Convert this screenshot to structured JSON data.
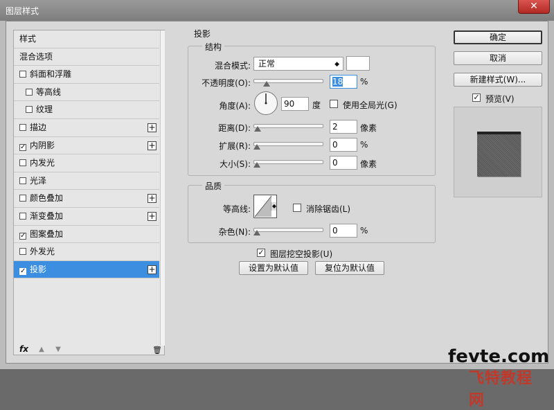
{
  "window": {
    "title": "图层样式",
    "close_label": "✕"
  },
  "list": {
    "header_label": "样式",
    "blend_options_label": "混合选项",
    "items": [
      {
        "label": "斜面和浮雕",
        "checked": false,
        "sub": false,
        "plus": false
      },
      {
        "label": "等高线",
        "checked": false,
        "sub": true,
        "plus": false
      },
      {
        "label": "纹理",
        "checked": false,
        "sub": true,
        "plus": false
      },
      {
        "label": "描边",
        "checked": false,
        "sub": false,
        "plus": true
      },
      {
        "label": "内阴影",
        "checked": true,
        "sub": false,
        "plus": true
      },
      {
        "label": "内发光",
        "checked": false,
        "sub": false,
        "plus": false
      },
      {
        "label": "光泽",
        "checked": false,
        "sub": false,
        "plus": false
      },
      {
        "label": "颜色叠加",
        "checked": false,
        "sub": false,
        "plus": true
      },
      {
        "label": "渐变叠加",
        "checked": false,
        "sub": false,
        "plus": true
      },
      {
        "label": "图案叠加",
        "checked": true,
        "sub": false,
        "plus": false
      },
      {
        "label": "外发光",
        "checked": false,
        "sub": false,
        "plus": false
      },
      {
        "label": "投影",
        "checked": true,
        "sub": false,
        "plus": true,
        "active": true
      }
    ],
    "fx_label": "fx",
    "up_icon": "▲",
    "down_icon": "▼",
    "trash_icon": "🗑",
    "plus_icon": "+",
    "check_mark": "✓"
  },
  "drop_shadow": {
    "section_title": "投影",
    "structure": {
      "title": "结构",
      "blend_mode_label": "混合模式:",
      "blend_mode_value": "正常",
      "blend_caret": "◆",
      "opacity_label": "不透明度(O):",
      "opacity_value": "18",
      "opacity_fraction": 0.18,
      "opacity_unit": "%",
      "angle_label": "角度(A):",
      "angle_value": "90",
      "angle_unit": "度",
      "global_light_label": "使用全局光(G)",
      "distance_label": "距离(D):",
      "distance_value": "2",
      "distance_unit": "像素",
      "spread_label": "扩展(R):",
      "spread_value": "0",
      "spread_unit": "%",
      "size_label": "大小(S):",
      "size_value": "0",
      "size_unit": "像素"
    },
    "quality": {
      "title": "品质",
      "contour_label": "等高线:",
      "anti_alias_label": "消除锯齿(L)",
      "noise_label": "杂色(N):",
      "noise_value": "0",
      "noise_unit": "%"
    },
    "knockout_label": "图层挖空投影(U)",
    "make_default_label": "设置为默认值",
    "reset_default_label": "复位为默认值"
  },
  "buttons": {
    "ok_label": "确定",
    "cancel_label": "取消",
    "new_style_label": "新建样式(W)...",
    "preview_label": "预览(V)"
  },
  "watermark": {
    "line1": "fevte.com",
    "line2": "飞特教程网"
  }
}
